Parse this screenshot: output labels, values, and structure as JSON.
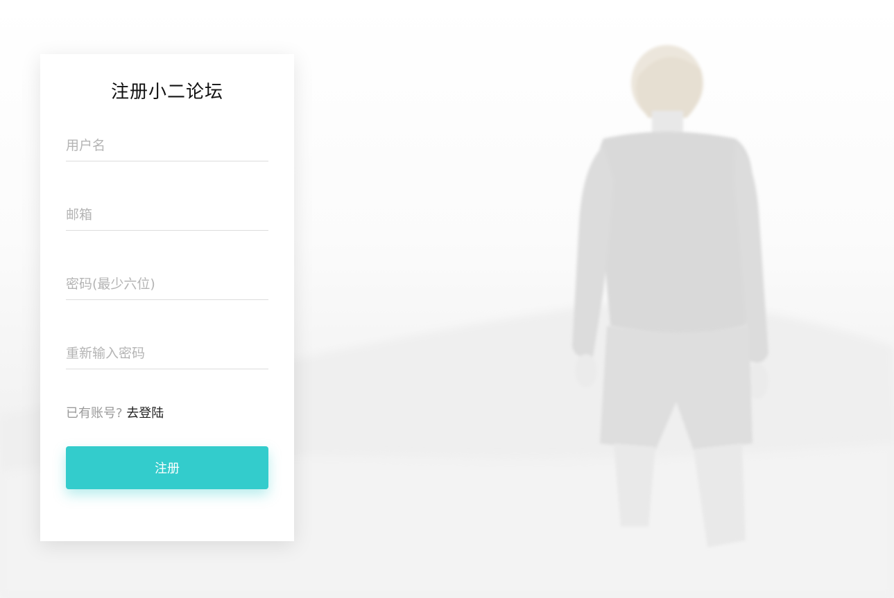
{
  "form": {
    "title": "注册小二论坛",
    "fields": [
      {
        "name": "username",
        "placeholder": "用户名",
        "value": ""
      },
      {
        "name": "email",
        "placeholder": "邮箱",
        "value": ""
      },
      {
        "name": "password",
        "placeholder": "密码(最少六位)",
        "value": ""
      },
      {
        "name": "password_confirm",
        "placeholder": "重新输入密码",
        "value": ""
      }
    ],
    "login_prompt": "已有账号?",
    "login_link": "去登陆",
    "submit_label": "注册"
  },
  "colors": {
    "accent": "#33cccc",
    "card_bg": "#ffffff",
    "placeholder": "#b4b4b4",
    "underline": "#dddddd"
  }
}
